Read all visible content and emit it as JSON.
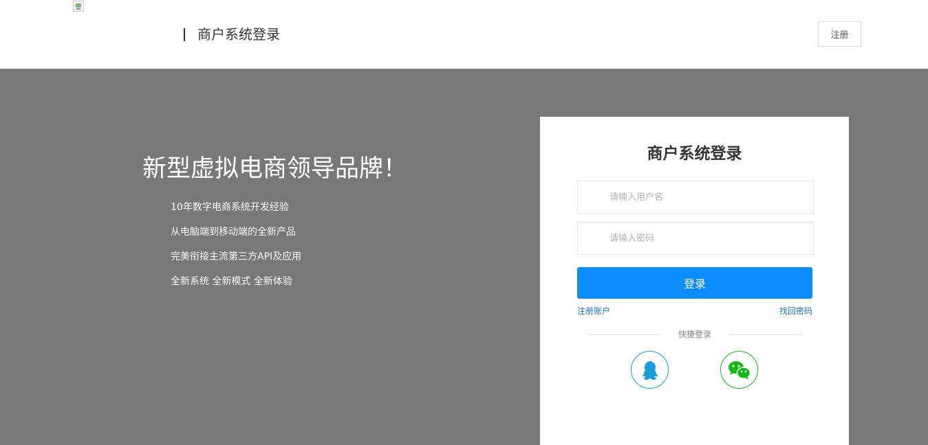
{
  "header": {
    "title": "商户系统登录",
    "register_label": "注册"
  },
  "banner": {
    "slogan": "新型虚拟电商领导品牌！",
    "features": [
      "10年数字电商系统开发经验",
      "从电脑端到移动端的全新产品",
      "完美衔接主流第三方API及应用",
      "全新系统 全新模式 全新体验"
    ]
  },
  "login": {
    "title": "商户系统登录",
    "username_placeholder": "请输入用户名",
    "password_placeholder": "请输入密码",
    "submit_label": "登录",
    "register_link": "注册账户",
    "forgot_link": "找回密码",
    "quick_login_label": "快捷登录",
    "social": [
      {
        "name": "qq-icon",
        "color": "#1a9ed8"
      },
      {
        "name": "wechat-icon",
        "color": "#16b816"
      }
    ]
  },
  "colors": {
    "accent": "#0a8cff",
    "banner_bg": "#787878",
    "link": "#1f6fc4"
  }
}
